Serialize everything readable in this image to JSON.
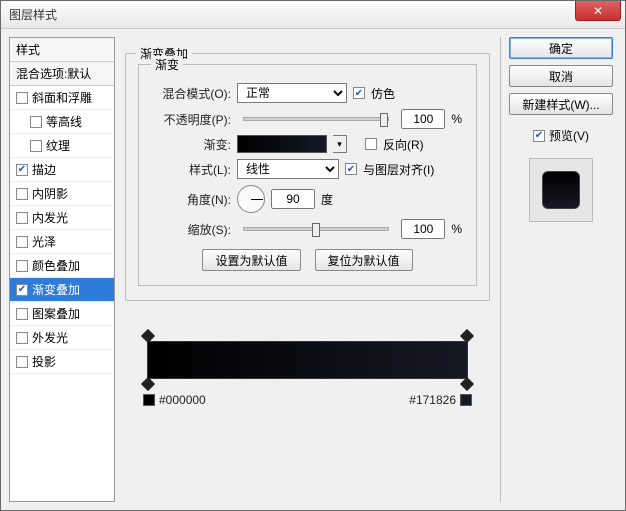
{
  "window": {
    "title": "图层样式"
  },
  "buttons": {
    "ok": "确定",
    "cancel": "取消",
    "new_style": "新建样式(W)...",
    "set_default": "设置为默认值",
    "reset_default": "复位为默认值"
  },
  "preview": {
    "checkbox_label": "预览(V)",
    "checked": true
  },
  "left": {
    "header": "样式",
    "subheader": "混合选项:默认",
    "items": [
      {
        "label": "斜面和浮雕",
        "checked": false,
        "indent": false
      },
      {
        "label": "等高线",
        "checked": false,
        "indent": true
      },
      {
        "label": "纹理",
        "checked": false,
        "indent": true
      },
      {
        "label": "描边",
        "checked": true,
        "indent": false
      },
      {
        "label": "内阴影",
        "checked": false,
        "indent": false
      },
      {
        "label": "内发光",
        "checked": false,
        "indent": false
      },
      {
        "label": "光泽",
        "checked": false,
        "indent": false
      },
      {
        "label": "颜色叠加",
        "checked": false,
        "indent": false
      },
      {
        "label": "渐变叠加",
        "checked": true,
        "indent": false,
        "selected": true
      },
      {
        "label": "图案叠加",
        "checked": false,
        "indent": false
      },
      {
        "label": "外发光",
        "checked": false,
        "indent": false
      },
      {
        "label": "投影",
        "checked": false,
        "indent": false
      }
    ]
  },
  "panel": {
    "group_title": "渐变叠加",
    "subgroup_title": "渐变",
    "blend_label": "混合模式(O):",
    "blend_value": "正常",
    "dither_label": "仿色",
    "dither_checked": true,
    "opacity_label": "不透明度(P):",
    "opacity_value": "100",
    "percent": "%",
    "gradient_label": "渐变:",
    "reverse_label": "反向(R)",
    "reverse_checked": false,
    "style_label": "样式(L):",
    "style_value": "线性",
    "align_label": "与图层对齐(I)",
    "align_checked": true,
    "angle_label": "角度(N):",
    "angle_value": "90",
    "angle_unit": "度",
    "scale_label": "缩放(S):",
    "scale_value": "100"
  },
  "gradient": {
    "stops": [
      {
        "color": "#000000",
        "hex": "#000000",
        "pos": 0
      },
      {
        "color": "#171826",
        "hex": "#171826",
        "pos": 100
      }
    ]
  }
}
